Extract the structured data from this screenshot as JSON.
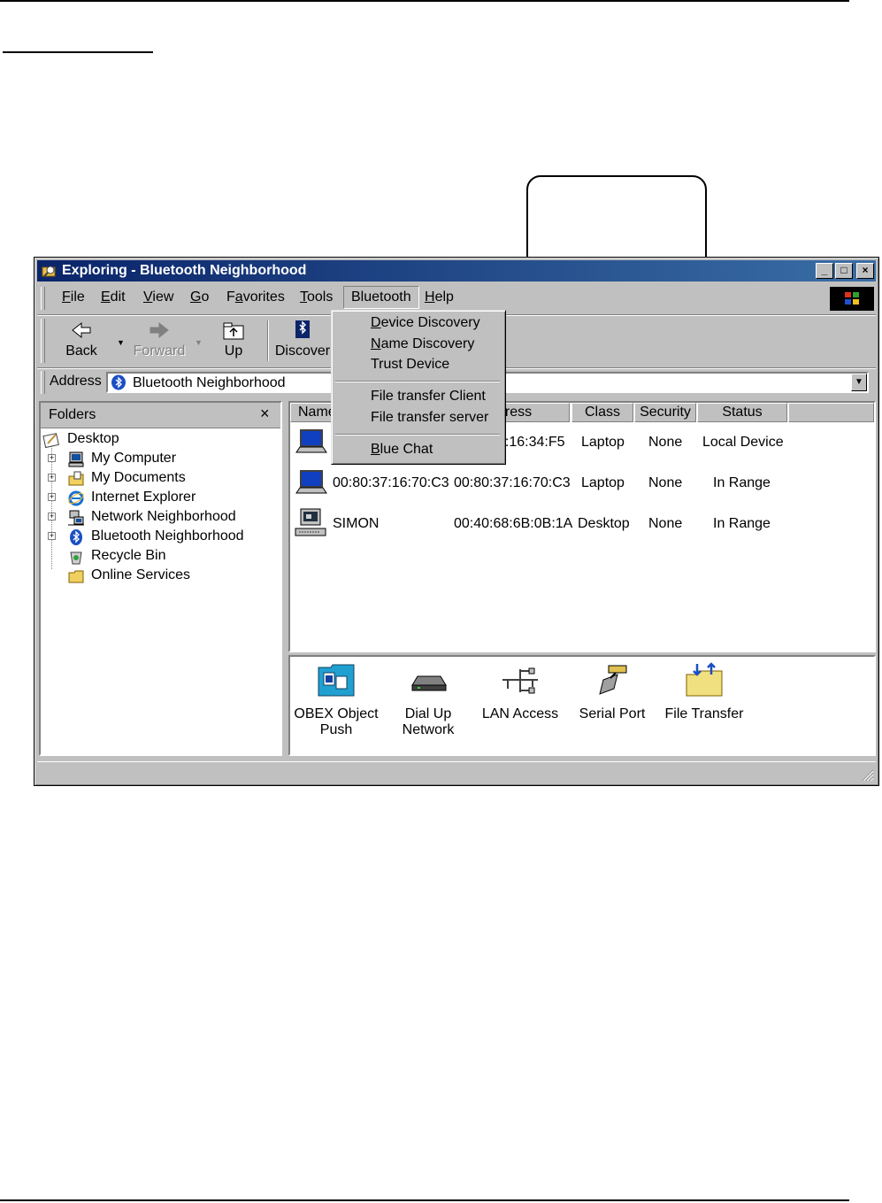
{
  "window": {
    "title": "Exploring - Bluetooth Neighborhood",
    "controls": {
      "minimize": "_",
      "maximize": "□",
      "close": "×"
    }
  },
  "menubar": {
    "items": [
      {
        "label": "File",
        "key": "F",
        "rest": "ile"
      },
      {
        "label": "Edit",
        "key": "E",
        "rest": "dit"
      },
      {
        "label": "View",
        "key": "V",
        "rest": "iew"
      },
      {
        "label": "Go",
        "key": "G",
        "rest": "o"
      },
      {
        "label": "Favorites",
        "pre": "F",
        "key": "a",
        "rest": "vorites"
      },
      {
        "label": "Tools",
        "key": "T",
        "rest": "ools"
      },
      {
        "label": "Bluetooth"
      },
      {
        "label": "Help",
        "key": "H",
        "rest": "elp"
      }
    ]
  },
  "bluetooth_menu": {
    "items": [
      {
        "label": "Device Discovery",
        "key": "D",
        "rest": "evice Discovery"
      },
      {
        "label": "Name Discovery",
        "key": "N",
        "rest": "ame Discovery"
      },
      {
        "label": "Trust Device"
      },
      {
        "label": "File transfer Client"
      },
      {
        "label": "File transfer server"
      },
      {
        "label": "Blue Chat",
        "key": "B",
        "rest": "lue Chat"
      }
    ]
  },
  "toolbar": {
    "back": "Back",
    "forward": "Forward",
    "up": "Up",
    "discover": "Discover"
  },
  "address": {
    "label": "Address",
    "value": "Bluetooth Neighborhood"
  },
  "folders": {
    "title": "Folders",
    "close": "×",
    "items": [
      "Desktop",
      "My Computer",
      "My Documents",
      "Internet Explorer",
      "Network Neighborhood",
      "Bluetooth Neighborhood",
      "Recycle Bin",
      "Online Services"
    ]
  },
  "device_list": {
    "columns": [
      "Name",
      "Address",
      "Class",
      "Security",
      "Status"
    ],
    "visible_column_labels": [
      "Name",
      "dress",
      "Class",
      "Security",
      "Status"
    ],
    "rows": [
      {
        "name": "G",
        "address": "7:16:34:F5",
        "class": "Laptop",
        "security": "None",
        "status": "Local Device"
      },
      {
        "name": "00:80:37:16:70:C3",
        "address": "00:80:37:16:70:C3",
        "class": "Laptop",
        "security": "None",
        "status": "In Range"
      },
      {
        "name": "SIMON",
        "address": "00:40:68:6B:0B:1A",
        "class": "Desktop",
        "security": "None",
        "status": "In Range"
      }
    ]
  },
  "services": [
    {
      "line1": "OBEX Object",
      "line2": "Push",
      "icon": "obex-icon"
    },
    {
      "line1": "Dial Up",
      "line2": "Network",
      "icon": "modem-icon"
    },
    {
      "line1": "LAN Access",
      "line2": "",
      "icon": "lan-icon"
    },
    {
      "line1": "Serial Port",
      "line2": "",
      "icon": "serial-port-icon"
    },
    {
      "line1": "File Transfer",
      "line2": "",
      "icon": "file-transfer-folder-icon"
    }
  ],
  "colors": {
    "title_gradient_start": "#0a246a",
    "title_gradient_end": "#3a6ea5",
    "face": "#c0c0c0",
    "bluetooth_blue": "#1a4fc4"
  }
}
